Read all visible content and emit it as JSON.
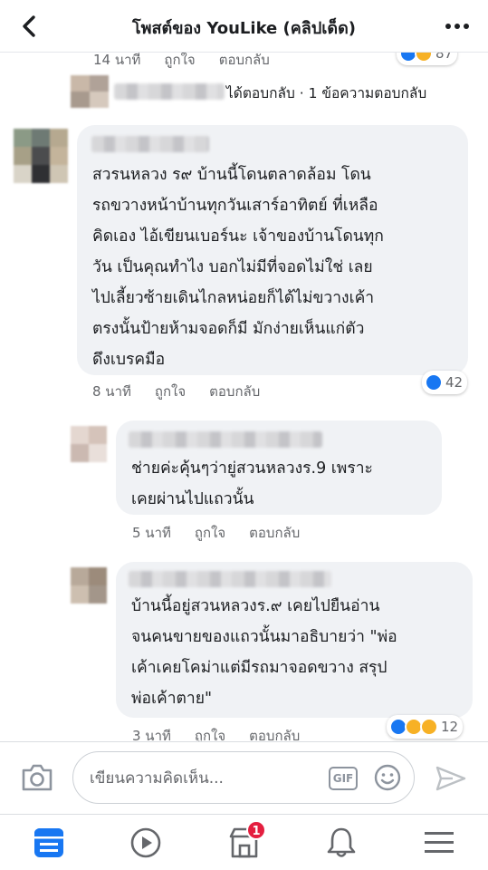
{
  "header": {
    "title": "โพสต์ของ YouLike (คลิปเด็ด)"
  },
  "top_comment_meta": {
    "time": "14 นาที",
    "like": "ถูกใจ",
    "reply": "ตอบกลับ",
    "reaction_count": "87"
  },
  "reply_summary": {
    "text": "ได้ตอบกลับ · 1 ข้อความตอบกลับ"
  },
  "comments": [
    {
      "text": "สวรนหลวง ร๙  บ้านนี้โดนตลาดล้อม  โดน\nรถขวางหน้าบ้านทุกวันเสาร์อาทิตย์  ที่เหลือ\nคิดเอง  ไอ้เขียนเบอร์นะ เจ้าของบ้านโดนทุก\nวัน เป็นคุณทำไง  บอกไม่มีที่จอดไม่ใช่ เลย\nไปเลี้ยวซ้ายเดินไกลหน่อยก็ได้ไม่ขวางเค้า\nตรงนั้นป้ายห้ามจอดก็มี มักง่ายเห็นแก่ตัว\nดึงเบรคมือ",
      "time": "8 นาที",
      "like": "ถูกใจ",
      "reply": "ตอบกลับ",
      "reaction_count": "42"
    },
    {
      "text": "ช่ายค่ะคุ้นๆว่ายู่สวนหลวงร.9 เพราะ\nเคยผ่านไปแถวนั้น",
      "time": "5 นาที",
      "like": "ถูกใจ",
      "reply": "ตอบกลับ"
    },
    {
      "text": "บ้านนี้อยู่สวนหลวงร.๙ เคยไปยืนอ่าน\nจนคนขายของแถวนั้นมาอธิบายว่า \"พ่อ\nเค้าเคยโคม่าแต่มีรถมาจอดขวาง สรุป\nพ่อเค้าตาย\"",
      "time": "3 นาที",
      "like": "ถูกใจ",
      "reply": "ตอบกลับ",
      "reaction_count": "12"
    }
  ],
  "composer": {
    "placeholder": "เขียนความคิดเห็น...",
    "gif_label": "GIF"
  },
  "tabbar": {
    "marketplace_badge": "1"
  },
  "colors": {
    "facebook_blue": "#1877f2",
    "bubble_bg": "#f0f2f5",
    "badge_red": "#e41e3f"
  }
}
